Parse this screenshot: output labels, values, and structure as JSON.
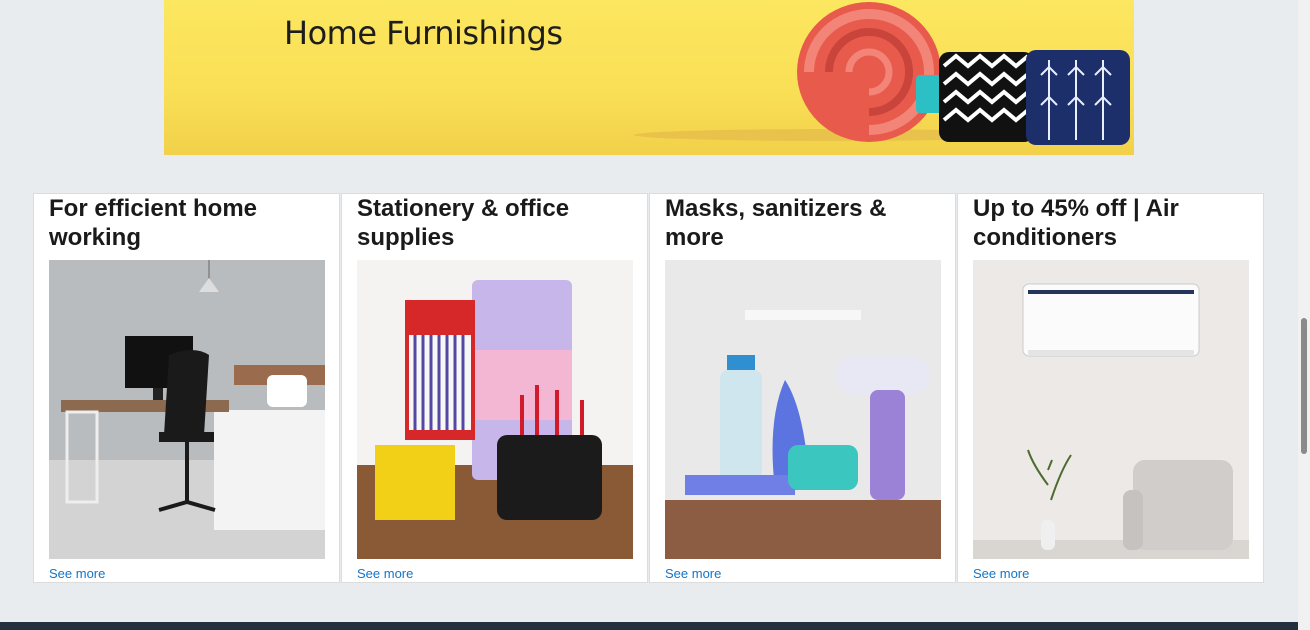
{
  "banner": {
    "title": "Home Furnishings"
  },
  "cards": [
    {
      "title": "For efficient home working",
      "link": "See more"
    },
    {
      "title": "Stationery & office supplies",
      "link": "See more"
    },
    {
      "title": "Masks, sanitizers & more",
      "link": "See more"
    },
    {
      "title": "Up to 45% off | Air conditioners",
      "link": "See more"
    }
  ]
}
